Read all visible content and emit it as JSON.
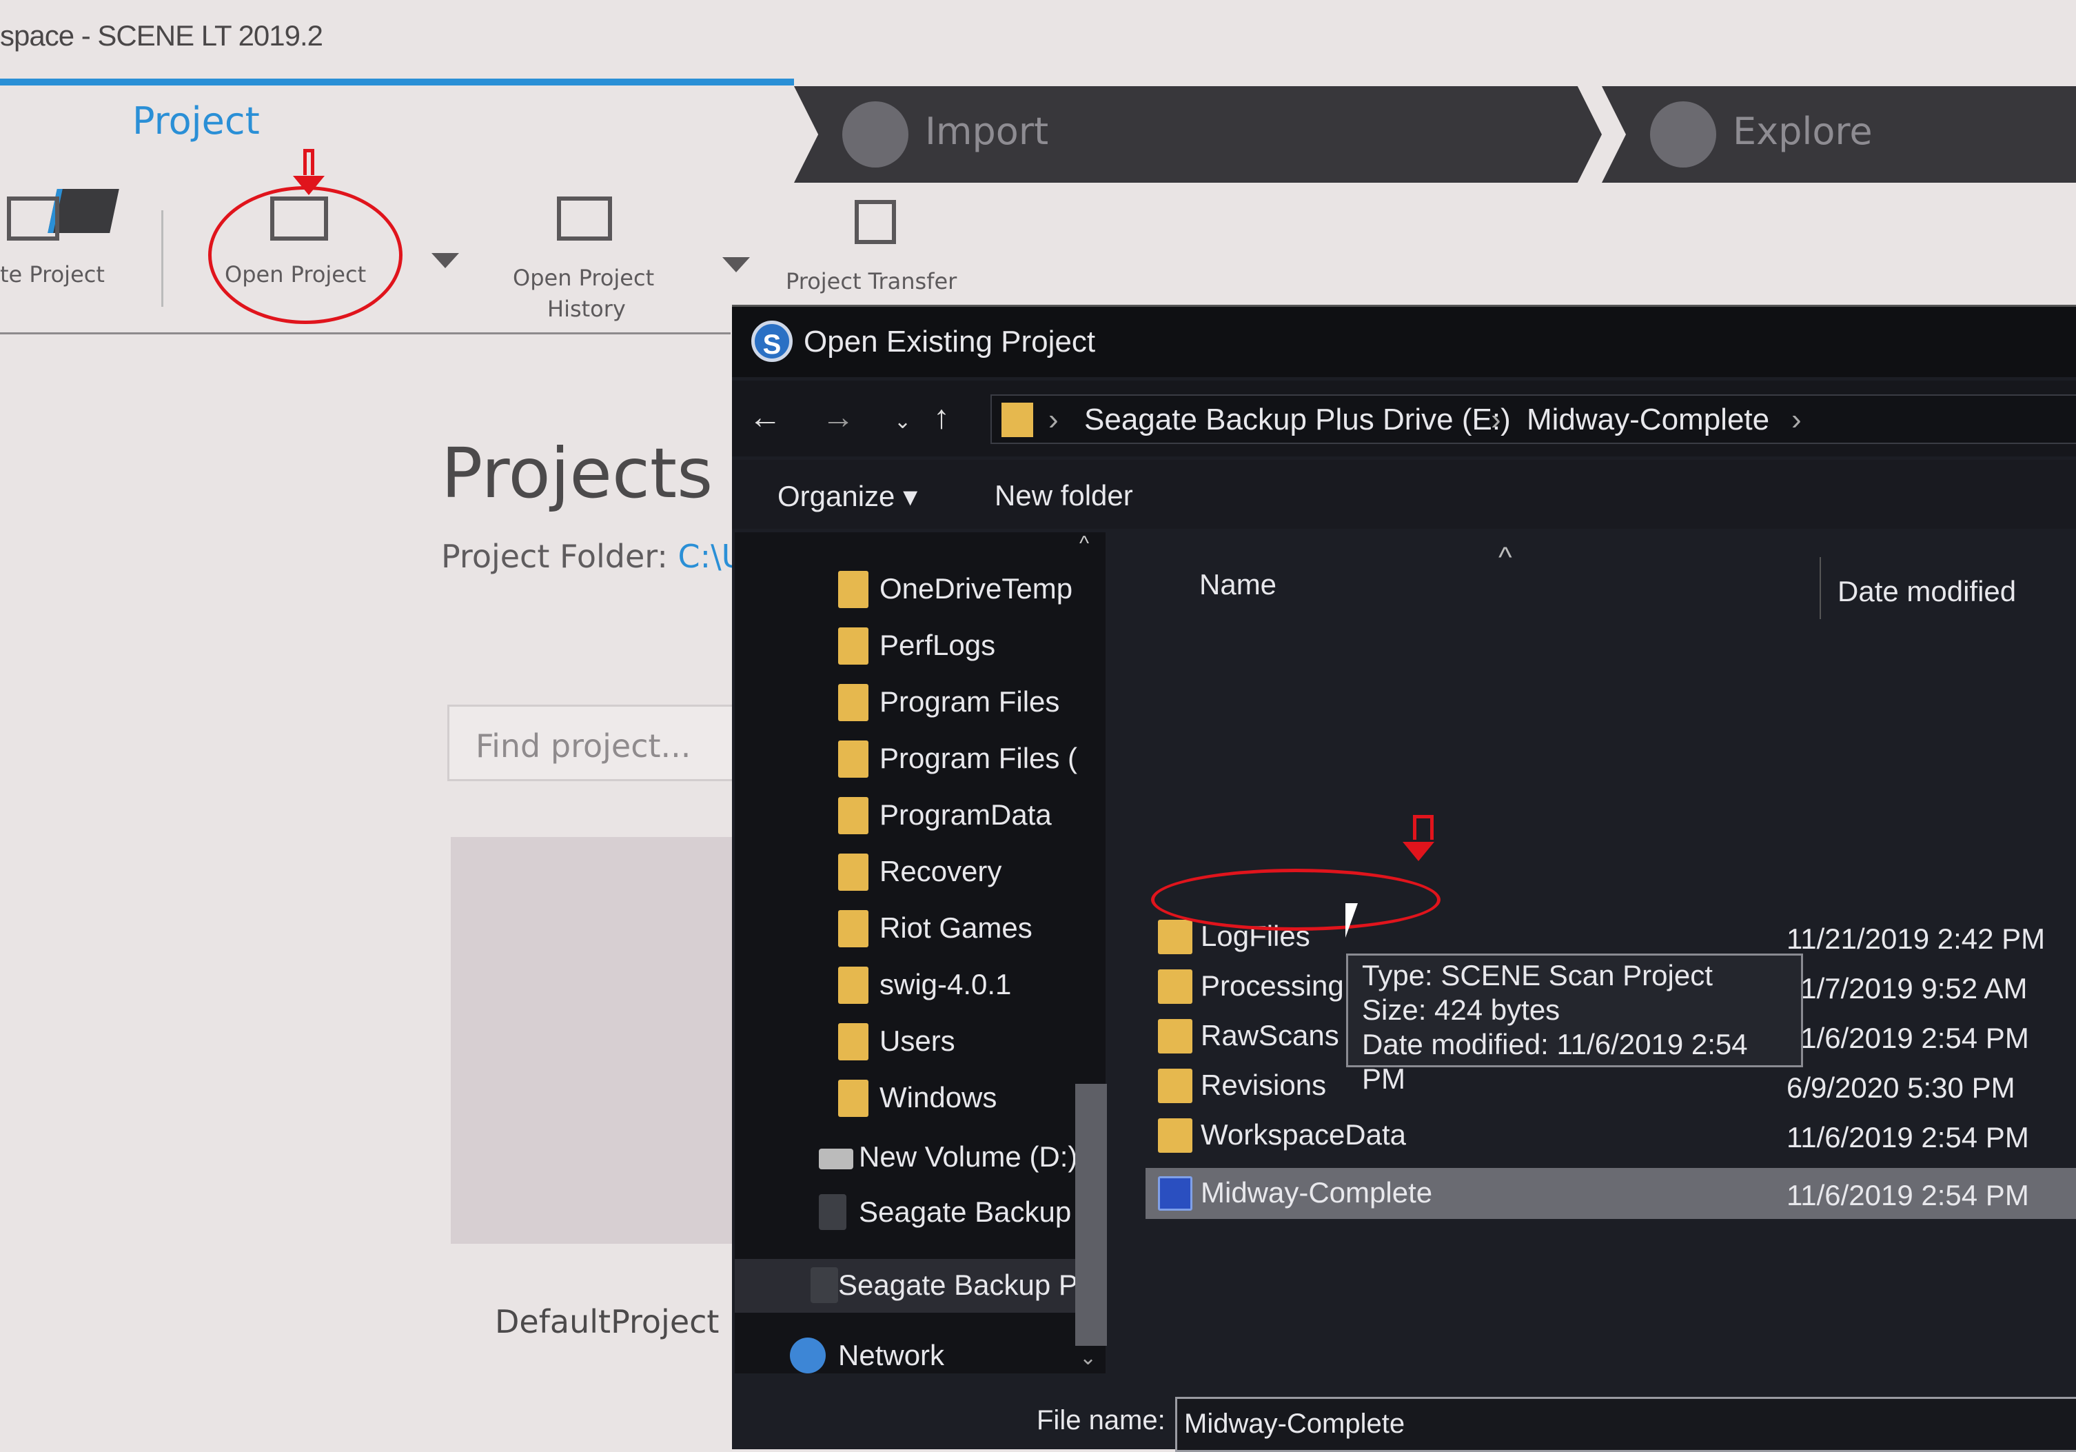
{
  "window": {
    "title": "space - SCENE LT 2019.2"
  },
  "tabs": [
    {
      "label": "Project",
      "active": true
    },
    {
      "label": "Import"
    },
    {
      "label": "Explore"
    }
  ],
  "toolbar": {
    "create_project": "te Project",
    "open_project": "Open Project",
    "open_project_history": [
      "Open Project",
      "History"
    ],
    "project_transfer": "Project Transfer"
  },
  "main": {
    "heading": "Projects",
    "folder_label": "Project Folder:",
    "folder_path": "C:\\U",
    "search_placeholder": "Find project...",
    "card_label": "DefaultProject"
  },
  "dialog": {
    "title": "Open Existing Project",
    "breadcrumb": [
      "Seagate Backup Plus Drive (E:)",
      "Midway-Complete"
    ],
    "organize": "Organize",
    "new_folder": "New folder",
    "nav_items": [
      {
        "label": "OneDriveTemp",
        "icon": "folder-icon"
      },
      {
        "label": "PerfLogs",
        "icon": "folder-icon"
      },
      {
        "label": "Program Files",
        "icon": "folder-icon"
      },
      {
        "label": "Program Files (",
        "icon": "folder-icon"
      },
      {
        "label": "ProgramData",
        "icon": "folder-icon"
      },
      {
        "label": "Recovery",
        "icon": "folder-icon"
      },
      {
        "label": "Riot Games",
        "icon": "folder-icon"
      },
      {
        "label": "swig-4.0.1",
        "icon": "folder-icon"
      },
      {
        "label": "Users",
        "icon": "folder-icon"
      },
      {
        "label": "Windows",
        "icon": "folder-icon"
      },
      {
        "label": "New Volume (D:)",
        "icon": "drive-icon"
      },
      {
        "label": "Seagate Backup",
        "icon": "drive-icon"
      },
      {
        "label": "Seagate Backup P",
        "icon": "drive-icon",
        "selected": true
      },
      {
        "label": "Network",
        "icon": "network-icon"
      }
    ],
    "columns": {
      "name": "Name",
      "date": "Date modified"
    },
    "files": [
      {
        "name": "LogFiles",
        "date": "11/21/2019 2:42 PM",
        "type": "folder"
      },
      {
        "name": "Processing",
        "date": "11/7/2019 9:52 AM",
        "type": "folder"
      },
      {
        "name": "RawScans",
        "date": "11/6/2019 2:54 PM",
        "type": "folder"
      },
      {
        "name": "Revisions",
        "date": "6/9/2020 5:30 PM",
        "type": "folder"
      },
      {
        "name": "WorkspaceData",
        "date": "11/6/2019 2:54 PM",
        "type": "folder"
      },
      {
        "name": "Midway-Complete",
        "date": "11/6/2019 2:54 PM",
        "type": "project",
        "selected": true
      }
    ],
    "tooltip": [
      "Type: SCENE Scan Project",
      "Size: 424 bytes",
      "Date modified: 11/6/2019 2:54 PM"
    ],
    "file_name_label": "File name:",
    "file_name_value": "Midway-Complete"
  },
  "colors": {
    "accent": "#2a8fd6",
    "annotation": "#e0141c",
    "dialog_bg": "#1c1e25",
    "folder": "#e6b84e"
  }
}
